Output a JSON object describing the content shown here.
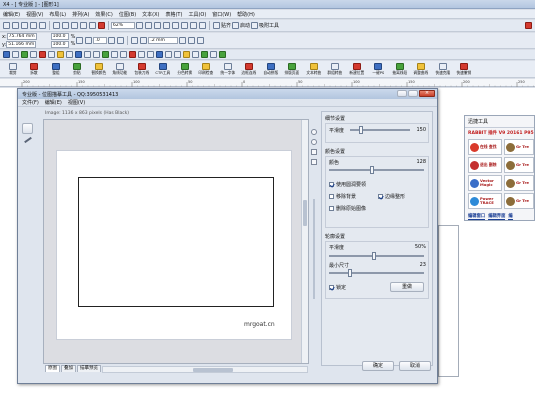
{
  "app": {
    "title": "X4 - [ 专业版 ] - [图形1]"
  },
  "menubar": [
    "编辑(E)",
    "视图(V)",
    "布局(L)",
    "排列(A)",
    "效果(C)",
    "位图(B)",
    "文本(X)",
    "表格(T)",
    "工具(O)",
    "窗口(W)",
    "帮助(H)"
  ],
  "toolbar1": {
    "zoom": "62%",
    "snap_label": "贴齐",
    "launch_label": "启动",
    "alignment_label": "吸附工具"
  },
  "propbar": {
    "x": "75.764 mm",
    "y": "51.166 mm",
    "scale_w": "100.0",
    "scale_h": "100.0",
    "pct": "%",
    "angle": ".0",
    "outline": ".2 mm"
  },
  "plugin_toolbar": [
    "裁剪",
    "拆散",
    "整组",
    "剪贴",
    "替换颜色",
    "角线功能",
    "包装刀线",
    "CTR工具",
    "分色转换",
    "印刷检查",
    "统一字体",
    "边框连线",
    "自动拼版",
    "排版页面",
    "文本转曲",
    "群组转曲",
    "新建位置",
    "一键PS",
    "抽离线段",
    "调整曲线",
    "快速克隆",
    "快速撤销"
  ],
  "ruler": {
    "ticks": [
      "200",
      "150",
      "100",
      "50",
      "0",
      "50",
      "100",
      "150",
      "200",
      "250"
    ]
  },
  "dialog": {
    "title": "专业版 - 位图描摹工具 - QQ:3950531413",
    "menu": [
      "文件(F)",
      "编辑(E)",
      "视图(V)"
    ],
    "info": "Image: 1136 x 863 pixels (Has Black)",
    "watermark": "mrgoat.cn",
    "tabs": [
      "原图",
      "叠加",
      "描摹预览"
    ],
    "sections": {
      "detail": {
        "title": "细节设置",
        "smooth_label": "平滑度",
        "smooth_value": "150"
      },
      "color": {
        "title": "颜色设置",
        "colors_label": "颜色",
        "colors_value": "128",
        "cb_merge": "使用圆润要领",
        "cb_merge_checked": true,
        "cb_remove_bg": "移除背景",
        "cb_remove_bg_checked": false,
        "cb_edge": "边缘整形",
        "cb_edge_checked": true,
        "cb_overlap": "删除原始图像",
        "cb_overlap_checked": false
      },
      "outline": {
        "title": "轮廓设置",
        "smooth_label": "平滑度",
        "smooth_value": "50%",
        "min_size_label": "最小尺寸",
        "min_size_value": "23",
        "cb_apply": "锁定",
        "cb_apply_checked": true,
        "apply_button": "重做"
      }
    },
    "buttons": {
      "ok": "确定",
      "cancel": "取消"
    }
  },
  "side_panel": {
    "title": "迅捷工具",
    "banner": "RABBIT 插件 V9 20161 P95",
    "items": [
      "在线 查找",
      "Gr Tre",
      "退出 删除",
      "Gr Tre",
      "Vector Magic",
      "Gr Tre",
      "Power TRACE",
      "Gr Tre"
    ],
    "bottom": [
      "编辑窗口",
      "编辑界面",
      "编"
    ]
  }
}
